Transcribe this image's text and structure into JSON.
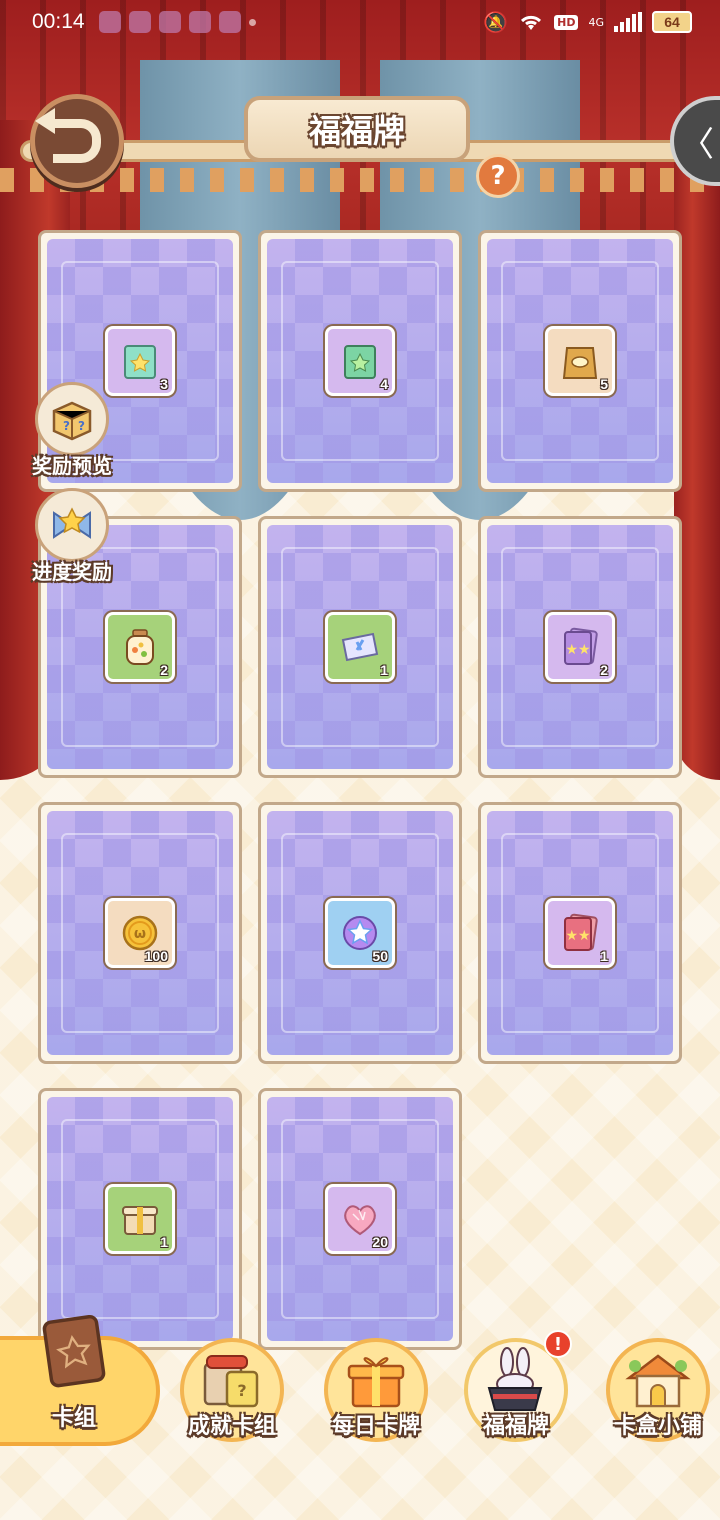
{
  "status_bar": {
    "time": "00:14",
    "hd": "HD",
    "network": "4G",
    "battery": "64"
  },
  "header": {
    "title": "福福牌",
    "help": "?",
    "side_arrow": "〈"
  },
  "side_buttons": {
    "reward_preview": "奖励预览",
    "progress_reward": "进度奖励"
  },
  "cards": [
    {
      "item": "star-snack-bag-icon",
      "count": "3"
    },
    {
      "item": "star-snack-bag-icon",
      "count": "4"
    },
    {
      "item": "fish-food-bag-icon",
      "count": "5"
    },
    {
      "item": "candy-jar-icon",
      "count": "2"
    },
    {
      "item": "ticket-icon",
      "count": "1"
    },
    {
      "item": "purple-star-packet-icon",
      "count": "2"
    },
    {
      "item": "gold-coin-icon",
      "count": "100"
    },
    {
      "item": "star-gem-icon",
      "count": "50"
    },
    {
      "item": "red-star-packet-icon",
      "count": "1"
    },
    {
      "item": "gift-box-icon",
      "count": "1"
    },
    {
      "item": "heart-crystal-icon",
      "count": "20"
    }
  ],
  "bottom_nav": {
    "items": [
      {
        "label": "卡组",
        "icon": "card-book-icon",
        "active": true
      },
      {
        "label": "成就卡组",
        "icon": "achievement-cards-icon",
        "active": false
      },
      {
        "label": "每日卡牌",
        "icon": "daily-gift-icon",
        "active": false
      },
      {
        "label": "福福牌",
        "icon": "magic-hat-bunny-icon",
        "active": false,
        "alert": "!"
      },
      {
        "label": "卡盒小铺",
        "icon": "shop-house-icon",
        "active": false
      }
    ]
  }
}
